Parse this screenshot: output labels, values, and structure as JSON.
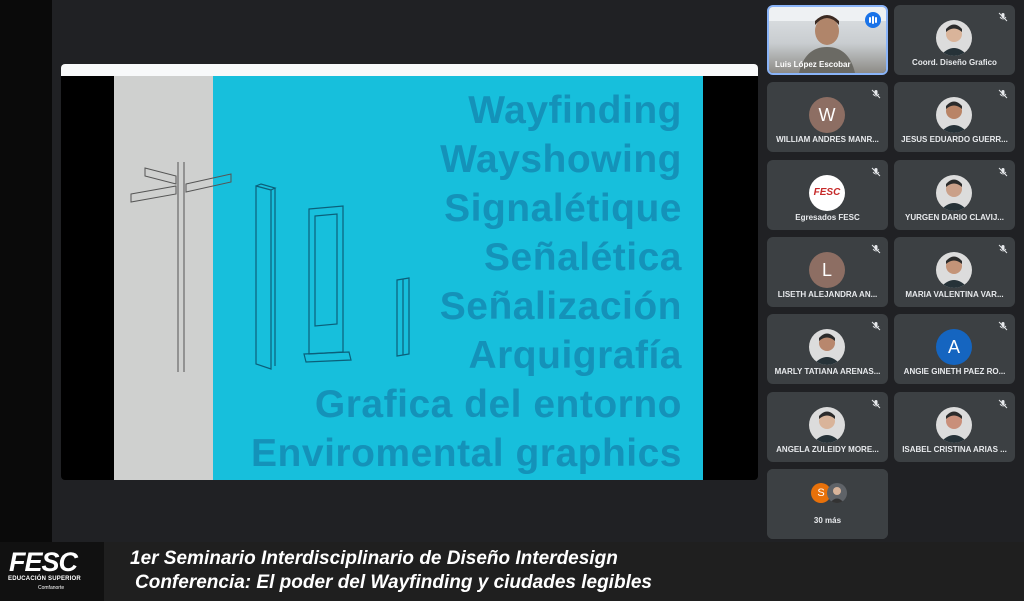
{
  "slide": {
    "words": [
      "Wayfinding",
      "Wayshowing",
      "Signalétique",
      "Señalética",
      "Señalización",
      "Arquigrafía",
      "Grafica del entorno",
      "Enviromental graphics"
    ]
  },
  "participants": {
    "self": {
      "name": "Luis López Escobar"
    },
    "tiles": [
      {
        "name": "Coord. Diseño Grafico",
        "avatar": "photo",
        "initial": ""
      },
      {
        "name": "WILLIAM ANDRES MANR...",
        "avatar": "letter",
        "initial": "W",
        "color": "#8d6e63"
      },
      {
        "name": "JESUS EDUARDO GUERR...",
        "avatar": "photo",
        "initial": ""
      },
      {
        "name": "Egresados FESC",
        "avatar": "logo",
        "initial": "FESC"
      },
      {
        "name": "YURGEN DARIO CLAVIJ...",
        "avatar": "photo",
        "initial": ""
      },
      {
        "name": "LISETH ALEJANDRA AN...",
        "avatar": "letter",
        "initial": "L",
        "color": "#8d6e63"
      },
      {
        "name": "MARIA VALENTINA VAR...",
        "avatar": "photo",
        "initial": ""
      },
      {
        "name": "MARLY TATIANA ARENAS...",
        "avatar": "photo",
        "initial": ""
      },
      {
        "name": "ANGIE GINETH PAEZ RO...",
        "avatar": "letter",
        "initial": "A",
        "color": "#1565c0"
      },
      {
        "name": "ANGELA ZULEIDY MORE...",
        "avatar": "photo",
        "initial": ""
      },
      {
        "name": "ISABEL CRISTINA ARIAS ...",
        "avatar": "photo",
        "initial": ""
      },
      {
        "name": "Coord. Diseño Grafico",
        "avatar": "photo",
        "initial": ""
      }
    ],
    "more": {
      "label": "30 más",
      "initial": "S"
    }
  },
  "banner": {
    "logo": "FESC",
    "logo_sub": "EDUCACIÓN SUPERIOR",
    "logo_sub2": "Comfanorte",
    "line1": "1er Seminario Interdisciplinario de Diseño Interdesign",
    "line2": "Conferencia: El poder del Wayfinding y ciudades legibles"
  },
  "colors": {
    "accent": "#8ab4f8",
    "slide_cyan": "#17bfdc",
    "slide_text": "#1492b9",
    "tile_bg": "#3c4043"
  }
}
